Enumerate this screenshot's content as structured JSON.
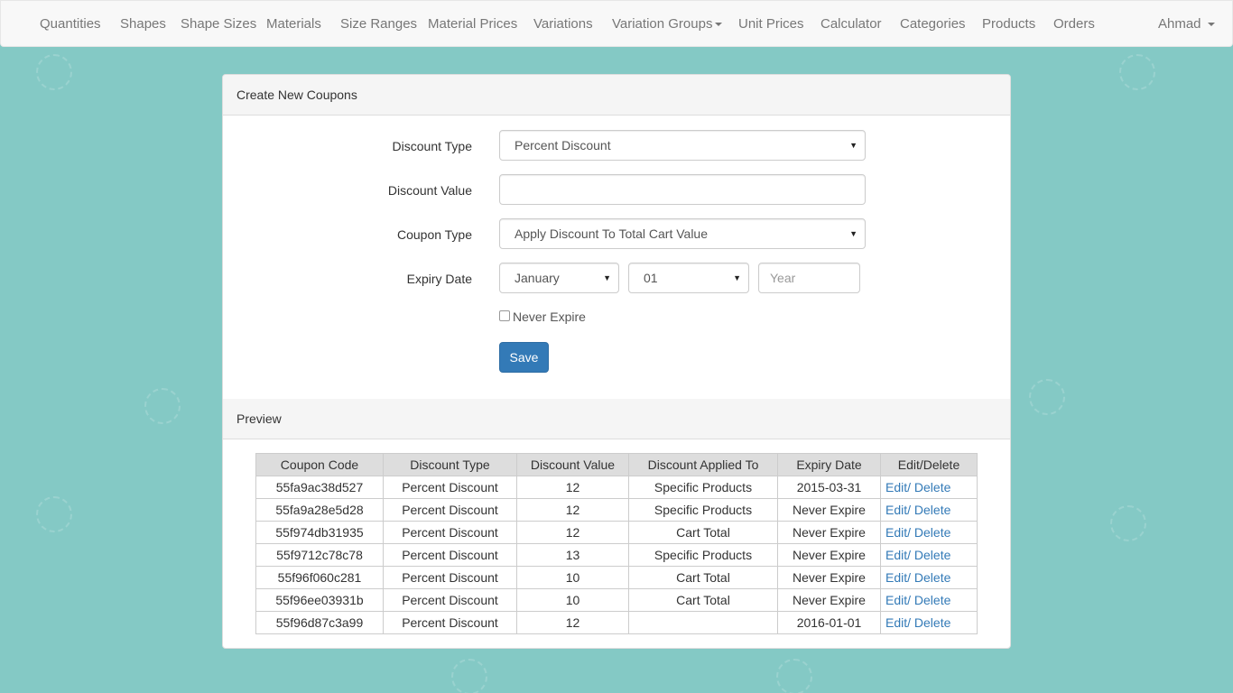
{
  "nav": {
    "items": [
      {
        "label": "Quantities"
      },
      {
        "label": "Shapes"
      },
      {
        "label": "Shape Sizes"
      },
      {
        "label": "Materials"
      },
      {
        "label": "Size Ranges"
      },
      {
        "label": "Material Prices"
      },
      {
        "label": "Variations"
      },
      {
        "label": "Variation Groups"
      },
      {
        "label": "Unit Prices"
      },
      {
        "label": "Calculator"
      },
      {
        "label": "Categories"
      },
      {
        "label": "Products"
      },
      {
        "label": "Orders"
      }
    ],
    "user": "Ahmad"
  },
  "create_panel": {
    "title": "Create New Coupons",
    "discount_type_label": "Discount Type",
    "discount_type_value": "Percent Discount",
    "discount_value_label": "Discount Value",
    "discount_value_value": "",
    "coupon_type_label": "Coupon Type",
    "coupon_type_value": "Apply Discount To Total Cart Value",
    "expiry_label": "Expiry Date",
    "expiry_month": "January",
    "expiry_day": "01",
    "expiry_year_placeholder": "Year",
    "never_expire_label": "Never Expire",
    "save_label": "Save"
  },
  "preview_panel": {
    "title": "Preview",
    "columns": [
      "Coupon Code",
      "Discount Type",
      "Discount Value",
      "Discount Applied To",
      "Expiry Date",
      "Edit/Delete"
    ],
    "edit_label": "Edit/",
    "delete_label": "Delete",
    "rows": [
      {
        "code": "55fa9ac38d527",
        "type": "Percent Discount",
        "value": "12",
        "applied_to": "Specific Products",
        "expiry": "2015-03-31"
      },
      {
        "code": "55fa9a28e5d28",
        "type": "Percent Discount",
        "value": "12",
        "applied_to": "Specific Products",
        "expiry": "Never Expire"
      },
      {
        "code": "55f974db31935",
        "type": "Percent Discount",
        "value": "12",
        "applied_to": "Cart Total",
        "expiry": "Never Expire"
      },
      {
        "code": "55f9712c78c78",
        "type": "Percent Discount",
        "value": "13",
        "applied_to": "Specific Products",
        "expiry": "Never Expire"
      },
      {
        "code": "55f96f060c281",
        "type": "Percent Discount",
        "value": "10",
        "applied_to": "Cart Total",
        "expiry": "Never Expire"
      },
      {
        "code": "55f96ee03931b",
        "type": "Percent Discount",
        "value": "10",
        "applied_to": "Cart Total",
        "expiry": "Never Expire"
      },
      {
        "code": "55f96d87c3a99",
        "type": "Percent Discount",
        "value": "12",
        "applied_to": "",
        "expiry": "2016-01-01"
      }
    ]
  },
  "colors": {
    "background": "#84c9c5",
    "primary": "#337ab7",
    "navbar": "#f8f8f8"
  }
}
